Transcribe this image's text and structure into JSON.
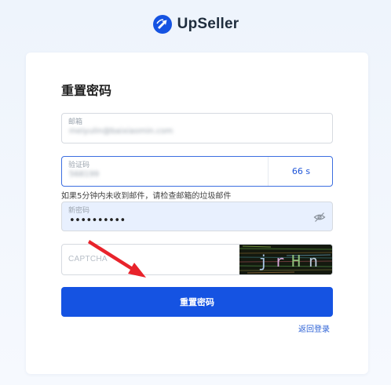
{
  "brand": {
    "name": "UpSeller",
    "color": "#1553e2"
  },
  "form": {
    "title": "重置密码",
    "email": {
      "label": "邮箱",
      "value": "meiyulin@baixiaomin.com"
    },
    "code": {
      "label": "验证码",
      "value": "568199",
      "countdown": "66 s"
    },
    "hint": "如果5分钟内未收到邮件，请检查邮箱的垃圾邮件",
    "password": {
      "label": "新密码",
      "value": "••••••••••",
      "toggle_icon": "eye-off-icon"
    },
    "captcha": {
      "placeholder": "CAPTCHA",
      "image_text": "jrHn"
    },
    "submit_label": "重置密码",
    "back_label": "返回登录"
  },
  "colors": {
    "accent": "#1553e2",
    "link": "#2d62d6",
    "annotation_arrow": "#e8232b"
  }
}
